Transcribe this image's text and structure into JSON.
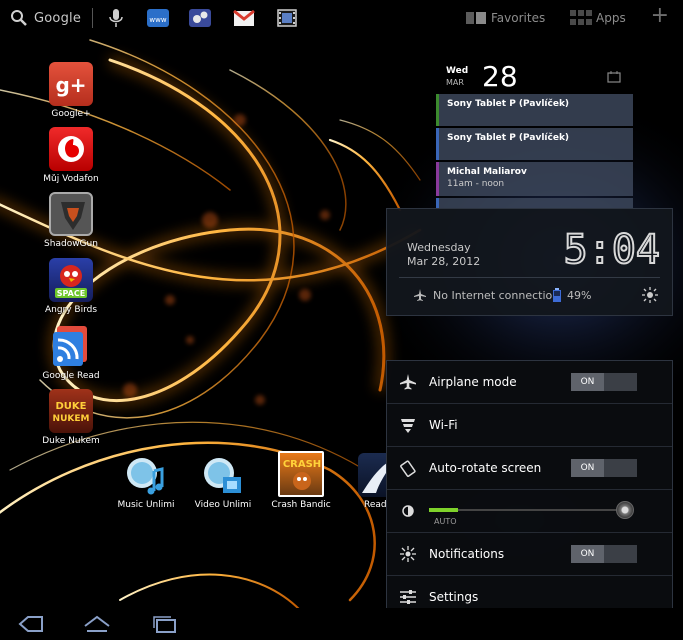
{
  "topbar": {
    "search_label": "Google",
    "favorites_label": "Favorites",
    "apps_label": "Apps",
    "add_label": "+"
  },
  "desktop_apps": [
    {
      "label": "Google+",
      "icon": "google-plus-icon"
    },
    {
      "label": "Můj Vodafon",
      "icon": "vodafone-icon"
    },
    {
      "label": "ShadowGun",
      "icon": "shadowgun-icon"
    },
    {
      "label": "Angry Birds",
      "icon": "angry-birds-icon"
    },
    {
      "label": "Google Read",
      "icon": "google-reader-icon"
    },
    {
      "label": "Duke Nukem",
      "icon": "duke-nukem-icon"
    }
  ],
  "dock_apps": [
    {
      "label": "Music Unlimi",
      "icon": "music-unlimited-icon"
    },
    {
      "label": "Video Unlimi",
      "icon": "video-unlimited-icon"
    },
    {
      "label": "Crash Bandic",
      "icon": "crash-bandicoot-icon"
    },
    {
      "label": "Read",
      "icon": "reader-icon"
    }
  ],
  "calendar": {
    "weekday": "Wed",
    "month": "MAR",
    "day": "28",
    "events": [
      {
        "title": "Sony Tablet P (Pavlíček)",
        "time": "",
        "color": "#3c8a2e"
      },
      {
        "title": "Sony Tablet P (Pavlíček)",
        "time": "",
        "color": "#3a66b8"
      },
      {
        "title": "Michal Maliarov",
        "time": "11am - noon",
        "color": "#8a3a9c"
      }
    ]
  },
  "status": {
    "weekday": "Wednesday",
    "date": "Mar 28, 2012",
    "time": "5:04",
    "connection": "No Internet connection",
    "battery": "49%"
  },
  "quick_settings": {
    "airplane_label": "Airplane mode",
    "airplane_state": "ON",
    "wifi_label": "Wi-Fi",
    "rotate_label": "Auto-rotate screen",
    "rotate_state": "ON",
    "brightness_auto": "AUTO",
    "brightness_level": 0.15,
    "notifications_label": "Notifications",
    "notifications_state": "ON",
    "settings_label": "Settings"
  },
  "colors": {
    "accent_green": "#7fd32b",
    "glow": "#ff9a1e"
  }
}
